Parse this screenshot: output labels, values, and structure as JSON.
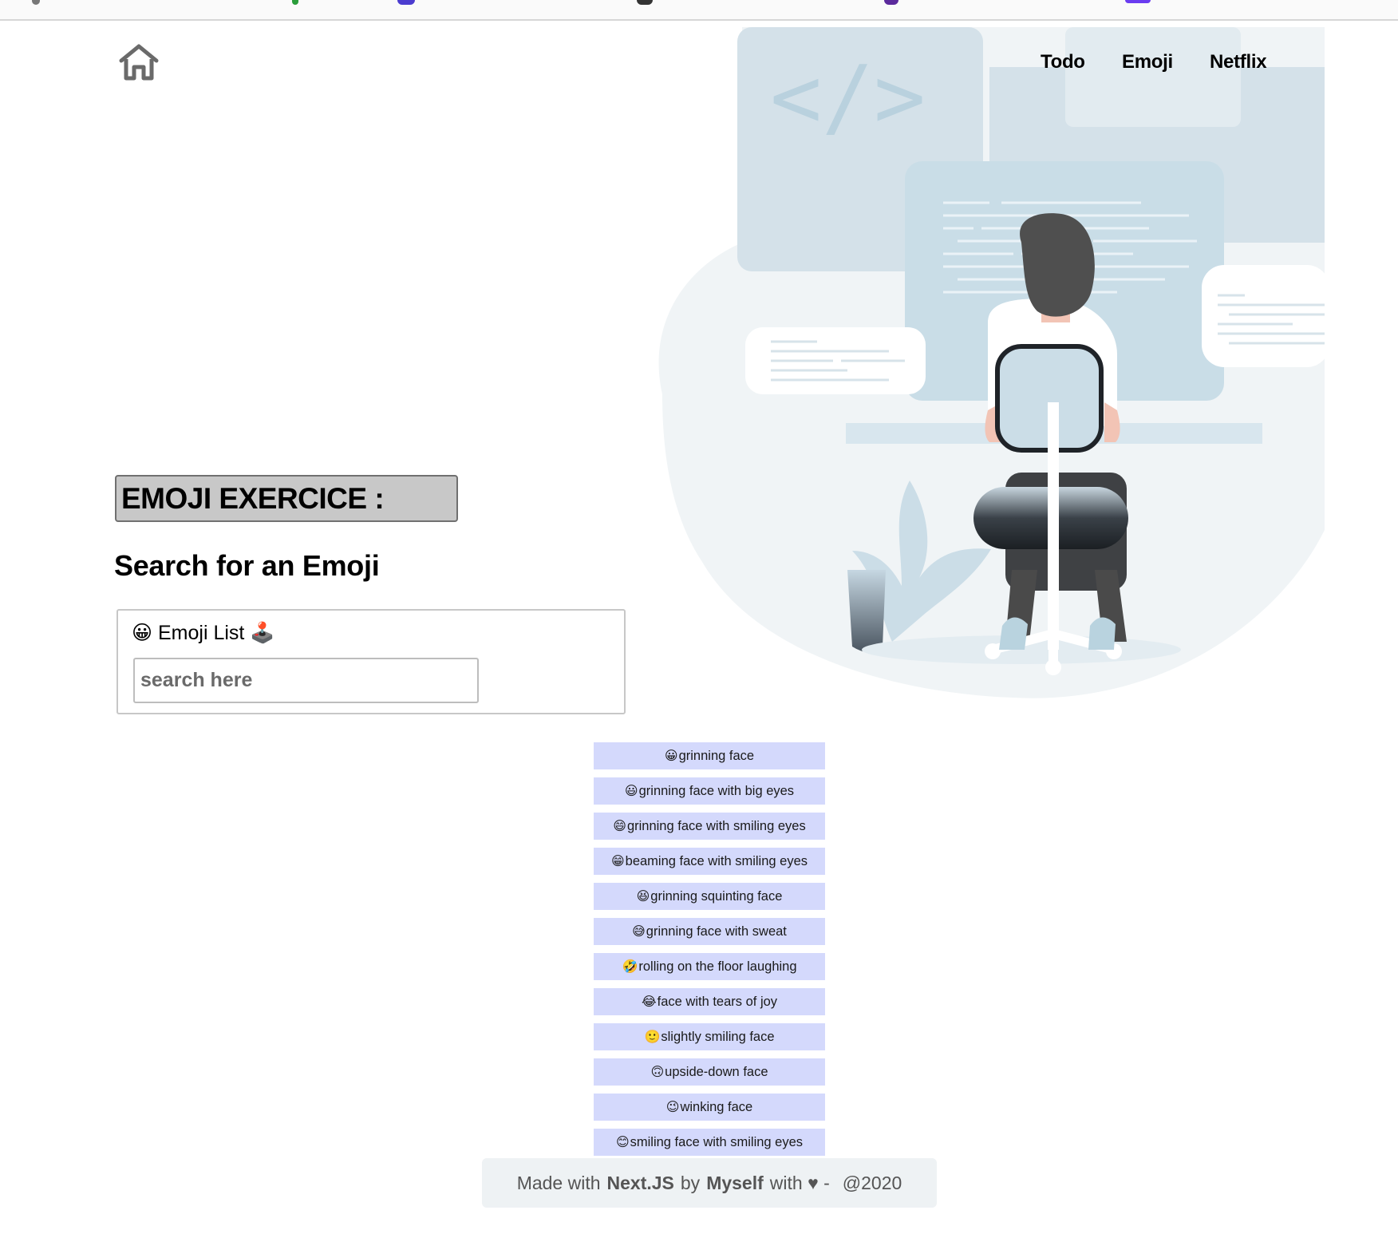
{
  "nav": {
    "links": [
      "Todo",
      "Emoji",
      "Netflix"
    ]
  },
  "main": {
    "exercise_title": "EMOJI EXERCICE :",
    "search_heading": "Search for an Emoji",
    "emoji_box": {
      "title": "😀 Emoji List 🕹️",
      "search_placeholder": "search here"
    }
  },
  "emoji_list": [
    {
      "emoji": "😀",
      "name": "grinning face"
    },
    {
      "emoji": "😃",
      "name": "grinning face with big eyes"
    },
    {
      "emoji": "😄",
      "name": "grinning face with smiling eyes"
    },
    {
      "emoji": "😁",
      "name": "beaming face with smiling eyes"
    },
    {
      "emoji": "😆",
      "name": "grinning squinting face"
    },
    {
      "emoji": "😅",
      "name": "grinning face with sweat"
    },
    {
      "emoji": "🤣",
      "name": "rolling on the floor laughing"
    },
    {
      "emoji": "😂",
      "name": "face with tears of joy"
    },
    {
      "emoji": "🙂",
      "name": "slightly smiling face"
    },
    {
      "emoji": "🙃",
      "name": "upside-down face"
    },
    {
      "emoji": "😉",
      "name": "winking face"
    },
    {
      "emoji": "😊",
      "name": "smiling face with smiling eyes"
    }
  ],
  "footer": {
    "made_with": "Made with",
    "framework": "Next.JS",
    "by": "by",
    "author": "Myself",
    "with_love": "with ♥ -",
    "year": "@2020"
  },
  "colors": {
    "list_item_bg": "#d4d9fc",
    "title_bg": "#c8c8c8",
    "footer_bg": "#eef2f4",
    "illustration_blue": "#c9dde7"
  },
  "icons": {
    "home": "home-icon",
    "illustration": "developer-at-desk-illustration"
  }
}
